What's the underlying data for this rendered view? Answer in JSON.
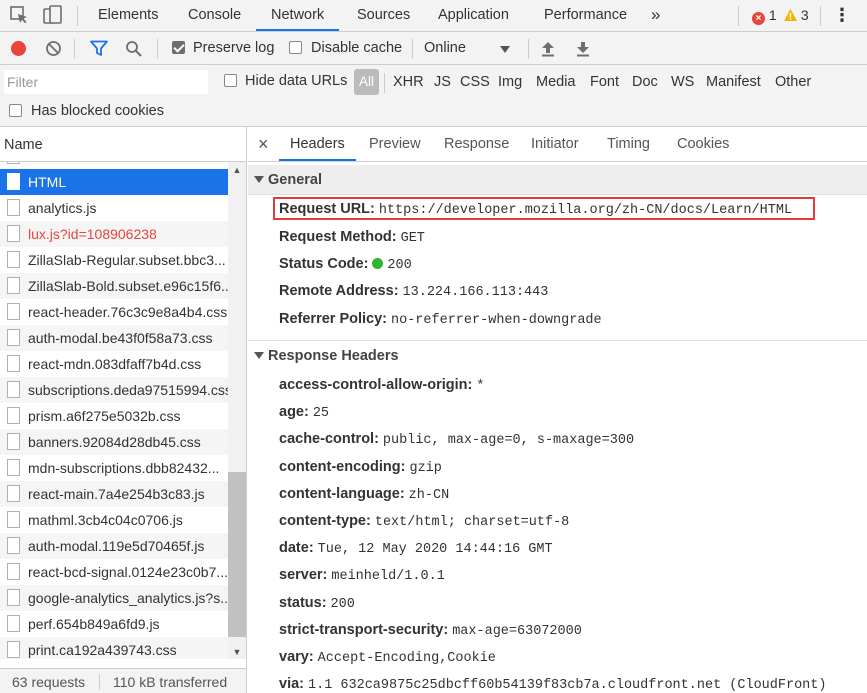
{
  "top_tabs": [
    "Elements",
    "Console",
    "Network",
    "Sources",
    "Application",
    "Performance"
  ],
  "top_more": "»",
  "error_count": "1",
  "warning_count": "3",
  "kebab": "⋮",
  "toolbar": {
    "preserve_log": "Preserve log",
    "preserve_log_checked": true,
    "disable_cache": "Disable cache",
    "disable_cache_checked": false,
    "throttle": "Online"
  },
  "filter": {
    "placeholder": "Filter",
    "hide_data_urls": "Hide data URLs",
    "types": [
      "All",
      "XHR",
      "JS",
      "CSS",
      "Img",
      "Media",
      "Font",
      "Doc",
      "WS",
      "Manifest",
      "Other"
    ],
    "has_blocked_cookies": "Has blocked cookies"
  },
  "list": {
    "header": "Name",
    "partial_top_row": "...",
    "rows": [
      {
        "name": "HTML",
        "state": "selected"
      },
      {
        "name": "analytics.js",
        "state": ""
      },
      {
        "name": "lux.js?id=108906238",
        "state": "error"
      },
      {
        "name": "ZillaSlab-Regular.subset.bbc3...",
        "state": ""
      },
      {
        "name": "ZillaSlab-Bold.subset.e96c15f6...",
        "state": ""
      },
      {
        "name": "react-header.76c3c9e8a4b4.css",
        "state": ""
      },
      {
        "name": "auth-modal.be43f0f58a73.css",
        "state": ""
      },
      {
        "name": "react-mdn.083dfaff7b4d.css",
        "state": ""
      },
      {
        "name": "subscriptions.deda97515994.css",
        "state": ""
      },
      {
        "name": "prism.a6f275e5032b.css",
        "state": ""
      },
      {
        "name": "banners.92084d28db45.css",
        "state": ""
      },
      {
        "name": "mdn-subscriptions.dbb82432...",
        "state": ""
      },
      {
        "name": "react-main.7a4e254b3c83.js",
        "state": ""
      },
      {
        "name": "mathml.3cb4c04c0706.js",
        "state": ""
      },
      {
        "name": "auth-modal.119e5d70465f.js",
        "state": ""
      },
      {
        "name": "react-bcd-signal.0124e23c0b7...",
        "state": ""
      },
      {
        "name": "google-analytics_analytics.js?s...",
        "state": ""
      },
      {
        "name": "perf.654b849a6fd9.js",
        "state": ""
      },
      {
        "name": "print.ca192a439743.css",
        "state": ""
      }
    ],
    "requests": "63 requests",
    "transferred": "110 kB transferred"
  },
  "detail_tabs": [
    "Headers",
    "Preview",
    "Response",
    "Initiator",
    "Timing",
    "Cookies"
  ],
  "detail_close": "×",
  "general": {
    "title": "General",
    "request_url_key": "Request URL:",
    "request_url": "https://developer.mozilla.org/zh-CN/docs/Learn/HTML",
    "request_method_key": "Request Method:",
    "request_method": "GET",
    "status_code_key": "Status Code:",
    "status_code": "200",
    "remote_address_key": "Remote Address:",
    "remote_address": "13.224.166.113:443",
    "referrer_policy_key": "Referrer Policy:",
    "referrer_policy": "no-referrer-when-downgrade"
  },
  "response_headers": {
    "title": "Response Headers",
    "items": [
      {
        "key": "access-control-allow-origin:",
        "value": "*"
      },
      {
        "key": "age:",
        "value": "25"
      },
      {
        "key": "cache-control:",
        "value": "public, max-age=0, s-maxage=300"
      },
      {
        "key": "content-encoding:",
        "value": "gzip"
      },
      {
        "key": "content-language:",
        "value": "zh-CN"
      },
      {
        "key": "content-type:",
        "value": "text/html; charset=utf-8"
      },
      {
        "key": "date:",
        "value": "Tue, 12 May 2020 14:44:16 GMT"
      },
      {
        "key": "server:",
        "value": "meinheld/1.0.1"
      },
      {
        "key": "status:",
        "value": "200"
      },
      {
        "key": "strict-transport-security:",
        "value": "max-age=63072000"
      },
      {
        "key": "vary:",
        "value": "Accept-Encoding,Cookie"
      },
      {
        "key": "via:",
        "value": "1.1 632ca9875c25dbcff60b54139f83cb7a.cloudfront.net (CloudFront)"
      }
    ]
  },
  "colors": {
    "accent": "#1a73e8",
    "record": "#e8453c",
    "highlight_box": "#e13b3b",
    "status_ok": "#2fb52f"
  }
}
